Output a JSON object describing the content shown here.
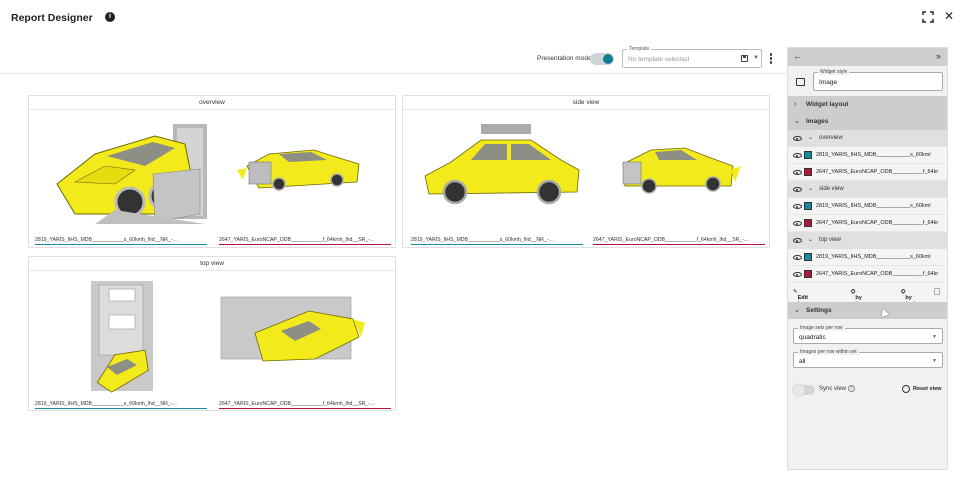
{
  "header": {
    "title": "Report Designer"
  },
  "toolbar": {
    "presentation_mode_label": "Presentation mode",
    "template_label": "Template",
    "template_placeholder": "No template selected"
  },
  "widgets": [
    {
      "title": "overview",
      "captions": [
        "2819_YARIS_IIHS_MDB___________s_60kmh_lhd__NR_-...",
        "2647_YARIS_EuroNCAP_ODB___________f_64kmh_lhd__SR_-..."
      ]
    },
    {
      "title": "side view",
      "captions": [
        "2819_YARIS_IIHS_MDB___________s_60kmh_lhd__NR_-...",
        "2647_YARIS_EuroNCAP_ODB___________f_64kmh_lhd__SR_-..."
      ]
    },
    {
      "title": "top view",
      "captions": [
        "2819_YARIS_IIHS_MDB___________s_60kmh_lhd__NR_-...",
        "2647_YARIS_EuroNCAP_ODB___________f_64kmh_lhd__SR_-..."
      ]
    }
  ],
  "panel": {
    "widget_style_label": "Widget style",
    "widget_style_value": "Image",
    "widget_layout": "Widget layout",
    "images": "Images",
    "groups": [
      {
        "name": "overview",
        "items": [
          "2819_YARIS_IIHS_MDB___________s_60kml",
          "2647_YARIS_EuroNCAP_ODB__________f_64kr"
        ]
      },
      {
        "name": "side view",
        "items": [
          "2819_YARIS_IIHS_MDB___________s_60kml",
          "2647_YARIS_EuroNCAP_ODB__________f_64kr"
        ]
      },
      {
        "name": "top view",
        "items": [
          "2819_YARIS_IIHS_MDB___________s_60kml",
          "2647_YARIS_EuroNCAP_ODB__________f_64kr"
        ]
      }
    ],
    "actions": {
      "edit": "Edit images",
      "by_image_set": "by image set",
      "by_test": "by test"
    },
    "settings": "Settings",
    "image_sets_per_row_label": "Image sets per row",
    "image_sets_per_row_value": "quadratic",
    "images_per_row_label": "Images per row within set",
    "images_per_row_value": "all",
    "sync_view": "Sync view",
    "reset_view": "Reset view"
  },
  "colors": {
    "accent": "#0f7e8e",
    "series_a": "#178a9c",
    "series_b": "#b0173a",
    "car": "#f2ea1a"
  }
}
